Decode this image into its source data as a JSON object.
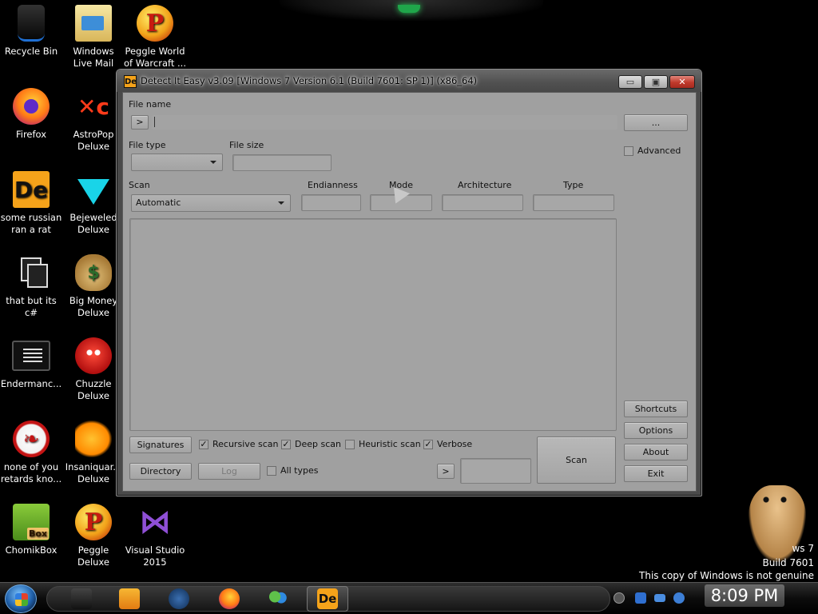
{
  "desktop": {
    "icons": [
      {
        "name": "recycle-bin",
        "label": "Recycle Bin",
        "glyph": ""
      },
      {
        "name": "windows-live-mail",
        "label": "Windows Live Mail",
        "glyph": ""
      },
      {
        "name": "peggle-world-of-warcraft",
        "label": "Peggle World of Warcraft ...",
        "glyph": "P"
      },
      {
        "name": "firefox",
        "label": "Firefox",
        "glyph": ""
      },
      {
        "name": "astropop-deluxe",
        "label": "AstroPop Deluxe",
        "glyph": "✕c"
      },
      {
        "name": "some-russian-ran-a-rat",
        "label": "some russian ran a rat",
        "glyph": "De"
      },
      {
        "name": "bejeweled-deluxe",
        "label": "Bejeweled Deluxe",
        "glyph": ""
      },
      {
        "name": "that-but-its-csharp",
        "label": "that but its c#",
        "glyph": ""
      },
      {
        "name": "big-money-deluxe",
        "label": "Big Money Deluxe",
        "glyph": "$"
      },
      {
        "name": "endermanch",
        "label": "Endermanc...",
        "glyph": ""
      },
      {
        "name": "chuzzle-deluxe",
        "label": "Chuzzle Deluxe",
        "glyph": ""
      },
      {
        "name": "none-of-you-retards",
        "label": "none of you retards kno...",
        "glyph": "❧"
      },
      {
        "name": "insaniquarium-deluxe",
        "label": "Insaniquar... Deluxe",
        "glyph": ""
      },
      {
        "name": "chomikbox",
        "label": "ChomikBox",
        "glyph": ""
      },
      {
        "name": "peggle-deluxe",
        "label": "Peggle Deluxe",
        "glyph": "P"
      },
      {
        "name": "visual-studio-2015",
        "label": "Visual Studio 2015",
        "glyph": "⋈"
      }
    ]
  },
  "window": {
    "title": "Detect It Easy v3.09 [Windows 7 Version 6.1 (Build 7601: SP 1)] (x86_64)",
    "icon_glyph": "De",
    "controls": {
      "minimize": "▭",
      "maximize": "▣",
      "close": "✕"
    },
    "file_name_label": "File name",
    "file_name_value": "",
    "browse_arrow": ">",
    "browse_button": "...",
    "file_type_label": "File type",
    "file_type_value": "",
    "file_size_label": "File size",
    "advanced_label": "Advanced",
    "scan_label": "Scan",
    "scan_mode_value": "Automatic",
    "endianness_label": "Endianness",
    "mode_label": "Mode",
    "architecture_label": "Architecture",
    "type_label": "Type",
    "side_buttons": {
      "shortcuts": "Shortcuts",
      "options": "Options",
      "about": "About",
      "exit": "Exit"
    },
    "signatures_button": "Signatures",
    "directory_button": "Directory",
    "log_button": "Log",
    "checks": {
      "recursive": {
        "label": "Recursive scan",
        "checked": true,
        "mark": "✓"
      },
      "deep": {
        "label": "Deep scan",
        "checked": true,
        "mark": "✓"
      },
      "heuristic": {
        "label": "Heuristic scan",
        "checked": false,
        "mark": ""
      },
      "verbose": {
        "label": "Verbose",
        "checked": true,
        "mark": "✓"
      },
      "all_types": {
        "label": "All types",
        "checked": false,
        "mark": ""
      }
    },
    "next_arrow": ">",
    "scan_button": "Scan"
  },
  "watermark": {
    "line1": "ws 7",
    "line2": "Build 7601",
    "line3": "This copy of Windows is not genuine"
  },
  "taskbar": {
    "apps": [
      "media-center",
      "media-player",
      "browser-globe",
      "firefox",
      "messenger",
      "detect-it-easy"
    ],
    "active_glyph": "De",
    "clock": "8:09 PM"
  },
  "colors": {
    "window_chrome": "#4a4a4a",
    "client_bg": "#a0a0a0",
    "close_button": "#c0392b",
    "die_orange": "#f5a31a"
  }
}
